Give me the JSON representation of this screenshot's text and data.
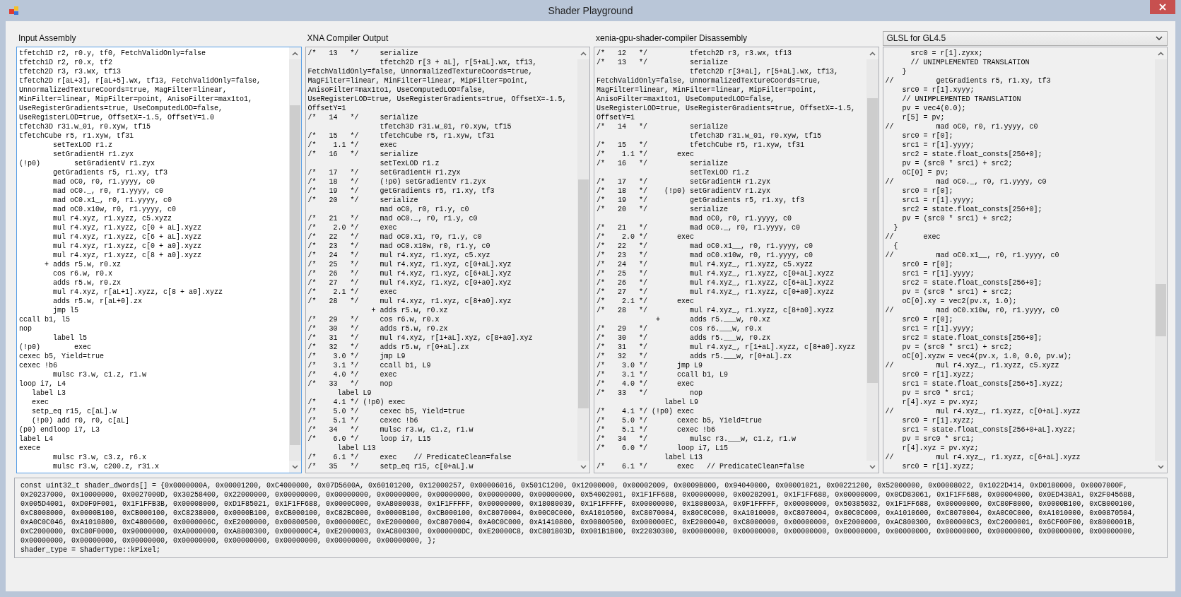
{
  "window": {
    "title": "Shader Playground"
  },
  "panels": [
    {
      "kind": "label",
      "label": "Input Assembly",
      "editable": true,
      "focused": true,
      "lines": [
        "tfetch1D r2, r0.y, tf0, FetchValidOnly=false",
        "tfetch1D r2, r0.x, tf2",
        "tfetch2D r3, r3.wx, tf13",
        "tfetch2D r[aL+3], r[aL+5].wx, tf13, FetchValidOnly=false,",
        "UnnormalizedTextureCoords=true, MagFilter=linear,",
        "MinFilter=linear, MipFilter=point, AnisoFilter=max1to1,",
        "UseRegisterGradients=true, UseComputedLOD=false,",
        "UseRegisterLOD=true, OffsetX=-1.5, OffsetY=1.0",
        "tfetch3D r31.w_01, r0.xyw, tf15",
        "tfetchCube r5, r1.xyw, tf31",
        "        setTexLOD r1.z",
        "        setGradientH r1.zyx",
        "(!p0)        setGradientV r1.zyx",
        "        getGradients r5, r1.xy, tf3",
        "        mad oC0, r0, r1.yyyy, c0",
        "        mad oC0._, r0, r1.yyyy, c0",
        "        mad oC0.x1_, r0, r1.yyyy, c0",
        "        mad oC0.x10w, r0, r1.yyyy, c0",
        "        mul r4.xyz, r1.xyzz, c5.xyzz",
        "        mul r4.xyz, r1.xyzz, c[0 + aL].xyzz",
        "        mul r4.xyz, r1.xyzz, c[6 + aL].xyzz",
        "        mul r4.xyz, r1.xyzz, c[0 + a0].xyzz",
        "        mul r4.xyz, r1.xyzz, c[8 + a0].xyzz",
        "      + adds r5.w, r0.xz",
        "        cos r6.w, r0.x",
        "        adds r5.w, r0.zx",
        "        mul r4.xyz, r[aL+1].xyzz, c[8 + a0].xyzz",
        "        adds r5.w, r[aL+0].zx",
        "        jmp l5",
        "ccall b1, l5",
        "nop",
        "        label l5",
        "(!p0)        exec",
        "cexec b5, Yield=true",
        "cexec !b6",
        "        mulsc r3.w, c1.z, r1.w",
        "loop i7, L4",
        "   label L3",
        "   exec",
        "   setp_eq r15, c[aL].w",
        "   (!p0) add r0, r0, c[aL]",
        "(p0) endloop i7, L3",
        "label L4",
        "exece",
        "        mulsc r3.w, c3.z, r6.x",
        "        mulsc r3.w, c200.z, r31.x"
      ]
    },
    {
      "kind": "label",
      "label": "XNA Compiler Output",
      "editable": false,
      "focused": false,
      "lines": [
        "/*   13   */     serialize",
        "                 tfetch2D r[3 + aL], r[5+aL].wx, tf13,",
        "FetchValidOnly=false, UnnormalizedTextureCoords=true,",
        "MagFilter=linear, MinFilter=linear, MipFilter=point,",
        "AnisoFilter=max1to1, UseComputedLOD=false,",
        "UseRegisterLOD=true, UseRegisterGradients=true, OffsetX=-1.5,",
        "OffsetY=1",
        "/*   14   */     serialize",
        "                 tfetch3D r31.w_01, r0.xyw, tf15",
        "/*   15   */     tfetchCube r5, r1.xyw, tf31",
        "/*    1.1 */     exec",
        "/*   16   */     serialize",
        "                 setTexLOD r1.z",
        "/*   17   */     setGradientH r1.zyx",
        "/*   18   */     (!p0) setGradientV r1.zyx",
        "/*   19   */     getGradients r5, r1.xy, tf3",
        "/*   20   */     serialize",
        "                 mad oC0, r0, r1.y, c0",
        "/*   21   */     mad oC0._, r0, r1.y, c0",
        "/*    2.0 */     exec",
        "/*   22   */     mad oC0.x1, r0, r1.y, c0",
        "/*   23   */     mad oC0.x10w, r0, r1.y, c0",
        "/*   24   */     mul r4.xyz, r1.xyz, c5.xyz",
        "/*   25   */     mul r4.xyz, r1.xyz, c[0+aL].xyz",
        "/*   26   */     mul r4.xyz, r1.xyz, c[6+aL].xyz",
        "/*   27   */     mul r4.xyz, r1.xyz, c[0+a0].xyz",
        "/*    2.1 */     exec",
        "/*   28   */     mul r4.xyz, r1.xyz, c[8+a0].xyz",
        "               + adds r5.w, r0.xz",
        "/*   29   */     cos r6.w, r0.x",
        "/*   30   */     adds r5.w, r0.zx",
        "/*   31   */     mul r4.xyz, r[1+aL].xyz, c[8+a0].xyz",
        "/*   32   */     adds r5.w, r[0+aL].zx",
        "/*    3.0 */     jmp L9",
        "/*    3.1 */     ccall b1, L9",
        "/*    4.0 */     exec",
        "/*   33   */     nop",
        "       label L9",
        "/*    4.1 */ (!p0) exec",
        "/*    5.0 */     cexec b5, Yield=true",
        "/*    5.1 */     cexec !b6",
        "/*   34   */     mulsc r3.w, c1.z, r1.w",
        "/*    6.0 */     loop i7, L15",
        "       label L13",
        "/*    6.1 */     exec    // PredicateClean=false",
        "/*   35   */     setp_eq r15, c[0+aL].w"
      ]
    },
    {
      "kind": "label",
      "label": "xenia-gpu-shader-compiler Disassembly",
      "editable": false,
      "focused": false,
      "lines": [
        "/*   12   */          tfetch2D r3, r3.wx, tf13",
        "/*   13   */          serialize",
        "                      tfetch2D r[3+aL], r[5+aL].wx, tf13,",
        "FetchValidOnly=false, UnnormalizedTextureCoords=true,",
        "MagFilter=linear, MinFilter=linear, MipFilter=point,",
        "AnisoFilter=max1to1, UseComputedLOD=false,",
        "UseRegisterLOD=true, UseRegisterGradients=true, OffsetX=-1.5,",
        "OffsetY=1",
        "/*   14   */          serialize",
        "                      tfetch3D r31.w_01, r0.xyw, tf15",
        "/*   15   */          tfetchCube r5, r1.xyw, tf31",
        "/*    1.1 */       exec",
        "/*   16   */          serialize",
        "                      setTexLOD r1.z",
        "/*   17   */          setGradientH r1.zyx",
        "/*   18   */    (!p0) setGradientV r1.zyx",
        "/*   19   */          getGradients r5, r1.xy, tf3",
        "/*   20   */          serialize",
        "                      mad oC0, r0, r1.yyyy, c0",
        "/*   21   */          mad oC0._, r0, r1.yyyy, c0",
        "/*    2.0 */       exec",
        "/*   22   */          mad oC0.x1__, r0, r1.yyyy, c0",
        "/*   23   */          mad oC0.x10w, r0, r1.yyyy, c0",
        "/*   24   */          mul r4.xyz_, r1.xyzz, c5.xyzz",
        "/*   25   */          mul r4.xyz_, r1.xyzz, c[0+aL].xyzz",
        "/*   26   */          mul r4.xyz_, r1.xyzz, c[6+aL].xyzz",
        "/*   27   */          mul r4.xyz_, r1.xyzz, c[0+a0].xyzz",
        "/*    2.1 */       exec",
        "/*   28   */          mul r4.xyz_, r1.xyzz, c[8+a0].xyzz",
        "              +       adds r5.___w, r0.xz",
        "/*   29   */          cos r6.___w, r0.x",
        "/*   30   */          adds r5.___w, r0.zx",
        "/*   31   */          mul r4.xyz_, r[1+aL].xyzz, c[8+a0].xyzz",
        "/*   32   */          adds r5.___w, r[0+aL].zx",
        "/*    3.0 */       jmp L9",
        "/*    3.1 */       ccall b1, L9",
        "/*    4.0 */       exec",
        "/*   33   */          nop",
        "                label L9",
        "/*    4.1 */ (!p0) exec",
        "/*    5.0 */       cexec b5, Yield=true",
        "/*    5.1 */       cexec !b6",
        "/*   34   */          mulsc r3.___w, c1.z, r1.w",
        "/*    6.0 */       loop i7, L15",
        "                label L13",
        "/*    6.1 */       exec   // PredicateClean=false"
      ]
    },
    {
      "kind": "dropdown",
      "label": "GLSL for GL4.5",
      "editable": false,
      "focused": false,
      "lines": [
        "      src0 = r[1].zyxx;",
        "      // UNIMPLEMENTED TRANSLATION",
        "    }",
        "//          getGradients r5, r1.xy, tf3",
        "    src0 = r[1].xyyy;",
        "    // UNIMPLEMENTED TRANSLATION",
        "    pv = vec4(0.0);",
        "    r[5] = pv;",
        "//          mad oC0, r0, r1.yyyy, c0",
        "    src0 = r[0];",
        "    src1 = r[1].yyyy;",
        "    src2 = state.float_consts[256+0];",
        "    pv = (src0 * src1) + src2;",
        "    oC[0] = pv;",
        "//          mad oC0._, r0, r1.yyyy, c0",
        "    src0 = r[0];",
        "    src1 = r[1].yyyy;",
        "    src2 = state.float_consts[256+0];",
        "    pv = (src0 * src1) + src2;",
        "  }",
        "//       exec",
        "  {",
        "//          mad oC0.x1__, r0, r1.yyyy, c0",
        "    src0 = r[0];",
        "    src1 = r[1].yyyy;",
        "    src2 = state.float_consts[256+0];",
        "    pv = (src0 * src1) + src2;",
        "    oC[0].xy = vec2(pv.x, 1.0);",
        "//          mad oC0.x10w, r0, r1.yyyy, c0",
        "    src0 = r[0];",
        "    src1 = r[1].yyyy;",
        "    src2 = state.float_consts[256+0];",
        "    pv = (src0 * src1) + src2;",
        "    oC[0].xyzw = vec4(pv.x, 1.0, 0.0, pv.w);",
        "//          mul r4.xyz_, r1.xyzz, c5.xyzz",
        "    src0 = r[1].xyzz;",
        "    src1 = state.float_consts[256+5].xyzz;",
        "    pv = src0 * src1;",
        "    r[4].xyz = pv.xyz;",
        "//          mul r4.xyz_, r1.xyzz, c[0+aL].xyzz",
        "    src0 = r[1].xyzz;",
        "    src1 = state.float_consts[256+0+aL].xyzz;",
        "    pv = src0 * src1;",
        "    r[4].xyz = pv.xyz;",
        "//          mul r4.xyz_, r1.xyzz, c[6+aL].xyzz",
        "    src0 = r[1].xyzz;"
      ]
    }
  ],
  "dwords": {
    "editable": false,
    "focused": false,
    "lines": [
      "const uint32_t shader_dwords[] = {0x0000000A, 0x00001200, 0xC4000000, 0x07D5600A, 0x60101200, 0x12000257, 0x00006016, 0x501C1200, 0x12000000, 0x00002009, 0x0009B000, 0x94040000, 0x00001021, 0x00221200, 0x52000000, 0x00008022, 0x1022D414, 0xD0180000, 0x0007000F,",
      "0x20237000, 0x10000000, 0x0027000D, 0x30258400, 0x22000000, 0x00000000, 0x00000000, 0x00000000, 0x00000000, 0x00000000, 0x00000000, 0x54002001, 0x1F1FF688, 0x00000000, 0x00282001, 0x1F1FF688, 0x00000000, 0x0CD83061, 0x1F1FF688, 0x00004000, 0x0ED438A1, 0x2F045688,",
      "0x005D4001, 0xD0F9F001, 0x1F1FFB3B, 0x00008000, 0xD1F85021, 0x1F1FF688, 0x0000C000, 0xA8080038, 0x1F1FFFFF, 0x00000000, 0x18080039, 0x1F1FFFFF, 0x00000000, 0x1808003A, 0x9F1FFFFF, 0x00000000, 0x50385032, 0x1F1FF688, 0x00000000, 0xC80F8000, 0x0000B100, 0xCB000100,",
      "0xC8008000, 0x0000B100, 0xCB000100, 0xC8238000, 0x0000B100, 0xCB000100, 0xC82BC000, 0x0000B100, 0xCB000100, 0xC8070004, 0x00C0C000, 0xA1010500, 0xC8070004, 0x80C0C000, 0xA1010000, 0xC8070004, 0x80C0C000, 0xA1010600, 0xC8070004, 0xA0C0C000, 0xA1010000, 0x00870504,",
      "0xA0C0C046, 0xA1010800, 0xC4800600, 0x0000006C, 0xE2000000, 0x00800500, 0x000000EC, 0xE2000000, 0xC8070004, 0xA0C0C000, 0xA1410800, 0x00800500, 0x000000EC, 0xE2000040, 0xC8000000, 0x00000000, 0xE2000000, 0xAC800300, 0x000000C3, 0xC2000001, 0x6CF00F00, 0x8000001B,",
      "0xC2000000, 0xC80F0000, 0x90000000, 0xA0000000, 0xA8800300, 0x000000C4, 0xE2000003, 0xAC800300, 0x000000DC, 0xE20000C8, 0xC801803D, 0x001B1B00, 0x22030300, 0x00000000, 0x00000000, 0x00000000, 0x00000000, 0x00000000, 0x00000000, 0x00000000, 0x00000000, 0x00000000,",
      "0x00000000, 0x00000000, 0x00000000, 0x00000000, 0x00000000, 0x00000000, 0x00000000, 0x00000000, };",
      "shader_type = ShaderType::kPixel;"
    ]
  }
}
